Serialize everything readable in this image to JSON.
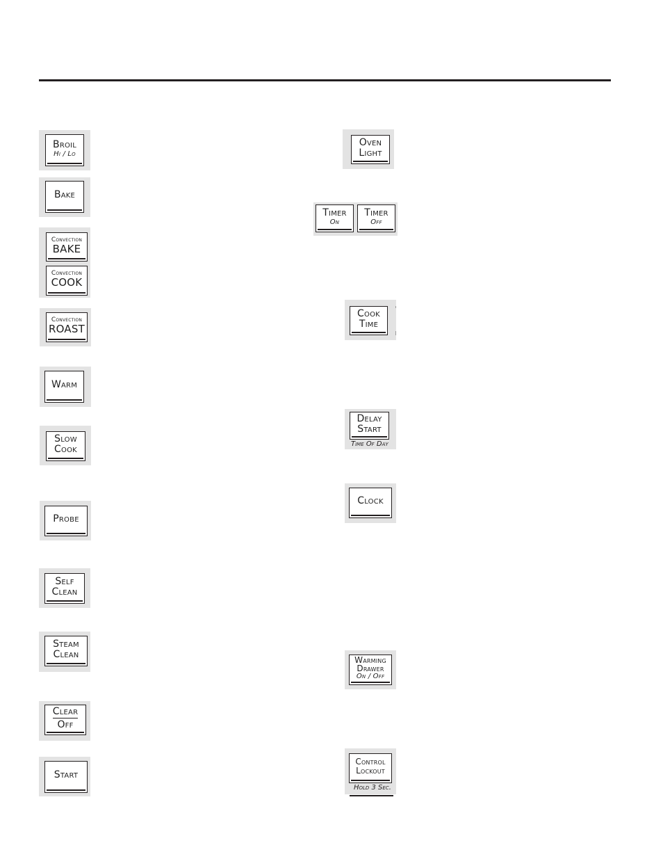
{
  "left_column": {
    "broil": {
      "lines": [
        "Broil",
        "Hi / Lo"
      ]
    },
    "bake": {
      "lines": [
        "Bake"
      ]
    },
    "convection_bake": {
      "lines": [
        "Convection",
        "BAKE"
      ]
    },
    "convection_cook": {
      "lines": [
        "Convection",
        "COOK"
      ]
    },
    "convection_roast": {
      "lines": [
        "Convection",
        "ROAST"
      ]
    },
    "warm": {
      "lines": [
        "Warm"
      ]
    },
    "slow_cook": {
      "lines": [
        "Slow",
        "Cook"
      ]
    },
    "probe": {
      "lines": [
        "Probe"
      ]
    },
    "self_clean": {
      "lines": [
        "Self",
        "Clean"
      ]
    },
    "steam_clean": {
      "lines": [
        "Steam",
        "Clean"
      ]
    },
    "clear_off": {
      "lines": [
        "Clear",
        "Off"
      ]
    },
    "start": {
      "lines": [
        "Start"
      ]
    }
  },
  "right_column": {
    "oven_light": {
      "lines": [
        "Oven",
        "Light"
      ]
    },
    "timer_on": {
      "lines": [
        "Timer",
        "On"
      ]
    },
    "timer_off": {
      "lines": [
        "Timer",
        "Off"
      ]
    },
    "cook_time": {
      "lines": [
        "Cook",
        "Time"
      ]
    },
    "delay_start": {
      "lines": [
        "Delay",
        "Start"
      ],
      "caption": "Time Of Day"
    },
    "clock": {
      "lines": [
        "Clock"
      ]
    },
    "warming_drawer": {
      "lines": [
        "Warming",
        "Drawer",
        "On / Off"
      ]
    },
    "control_lockout": {
      "lines": [
        "Control",
        "Lockout"
      ],
      "caption": "Hold 3 Sec."
    }
  }
}
